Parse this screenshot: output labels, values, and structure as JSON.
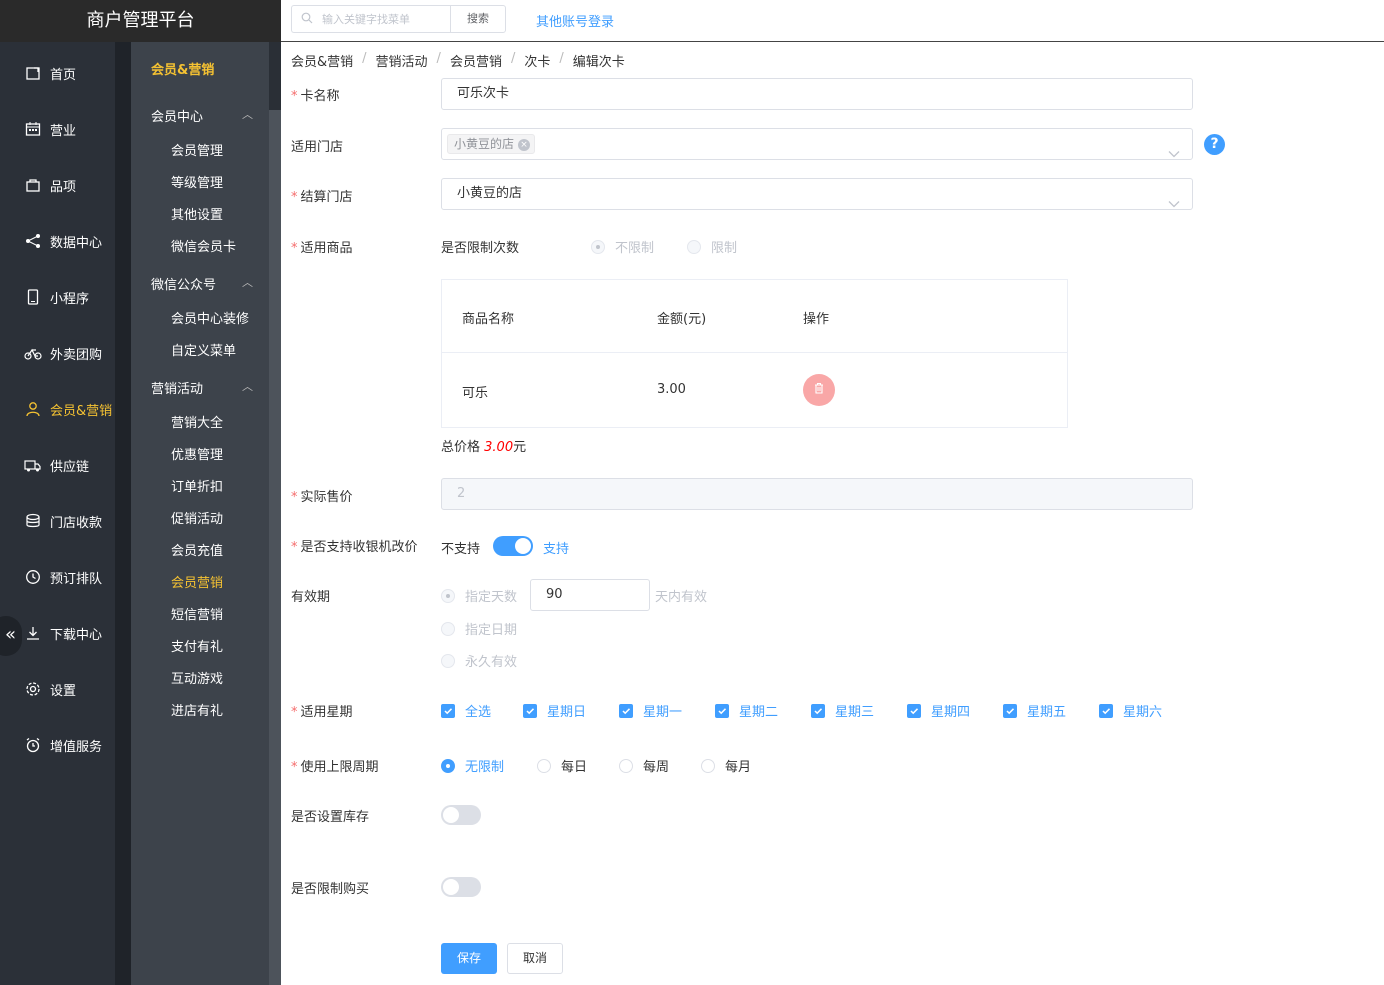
{
  "app": {
    "title": "商户管理平台"
  },
  "topbar": {
    "search_placeholder": "输入关键字找菜单",
    "search_button": "搜索",
    "other_login": "其他账号登录"
  },
  "nav": {
    "items": [
      {
        "label": "首页",
        "icon": "home-icon"
      },
      {
        "label": "营业",
        "icon": "calendar-icon"
      },
      {
        "label": "品项",
        "icon": "bag-icon"
      },
      {
        "label": "数据中心",
        "icon": "share-icon"
      },
      {
        "label": "小程序",
        "icon": "mobile-icon"
      },
      {
        "label": "外卖团购",
        "icon": "bicycle-icon"
      },
      {
        "label": "会员&营销",
        "icon": "user-icon",
        "active": true
      },
      {
        "label": "供应链",
        "icon": "truck-icon"
      },
      {
        "label": "门店收款",
        "icon": "database-icon"
      },
      {
        "label": "预订排队",
        "icon": "clock-icon"
      },
      {
        "label": "下载中心",
        "icon": "download-icon"
      },
      {
        "label": "设置",
        "icon": "gear-icon"
      },
      {
        "label": "增值服务",
        "icon": "alarm-icon"
      }
    ]
  },
  "submenu": {
    "title": "会员&营销",
    "groups": [
      {
        "label": "会员中心",
        "items": [
          "会员管理",
          "等级管理",
          "其他设置",
          "微信会员卡"
        ]
      },
      {
        "label": "微信公众号",
        "items": [
          "会员中心装修",
          "自定义菜单"
        ]
      },
      {
        "label": "营销活动",
        "items": [
          "营销大全",
          "优惠管理",
          "订单折扣",
          "促销活动",
          "会员充值",
          "会员营销",
          "短信营销",
          "支付有礼",
          "互动游戏",
          "进店有礼"
        ]
      }
    ],
    "active_item": "会员营销"
  },
  "breadcrumb": [
    "会员&营销",
    "营销活动",
    "会员营销",
    "次卡",
    "编辑次卡"
  ],
  "form": {
    "card_name": {
      "label": "卡名称",
      "value": "可乐次卡"
    },
    "stores": {
      "label": "适用门店",
      "tag": "小黄豆的店"
    },
    "settle_store": {
      "label": "结算门店",
      "value": "小黄豆的店"
    },
    "goods": {
      "label": "适用商品",
      "limit_label": "是否限制次数",
      "options": [
        "不限制",
        "限制"
      ],
      "table_headers": [
        "商品名称",
        "金额(元)",
        "操作"
      ],
      "rows": [
        {
          "name": "可乐",
          "amount": "3.00"
        }
      ],
      "total_prefix": "总价格 ",
      "total_value": "3.00",
      "total_suffix": "元"
    },
    "actual_price": {
      "label": "实际售价",
      "value": "2"
    },
    "price_change": {
      "label": "是否支持收银机改价",
      "off_text": "不支持",
      "on_text": "支持",
      "enabled": true
    },
    "validity": {
      "label": "有效期",
      "options": [
        "指定天数",
        "指定日期",
        "永久有效"
      ],
      "days": "90",
      "days_suffix": "天内有效"
    },
    "weekdays": {
      "label": "适用星期",
      "options": [
        "全选",
        "星期日",
        "星期一",
        "星期二",
        "星期三",
        "星期四",
        "星期五",
        "星期六"
      ]
    },
    "usage_period": {
      "label": "使用上限周期",
      "options": [
        "无限制",
        "每日",
        "每周",
        "每月"
      ],
      "selected": "无限制"
    },
    "stock": {
      "label": "是否设置库存",
      "enabled": false
    },
    "purchase_limit": {
      "label": "是否限制购买",
      "enabled": false
    }
  },
  "actions": {
    "save": "保存",
    "cancel": "取消"
  },
  "colors": {
    "primary": "#409eff",
    "accent": "#f5c232",
    "danger": "#f56c6c",
    "nav_bg": "#2b3038"
  }
}
